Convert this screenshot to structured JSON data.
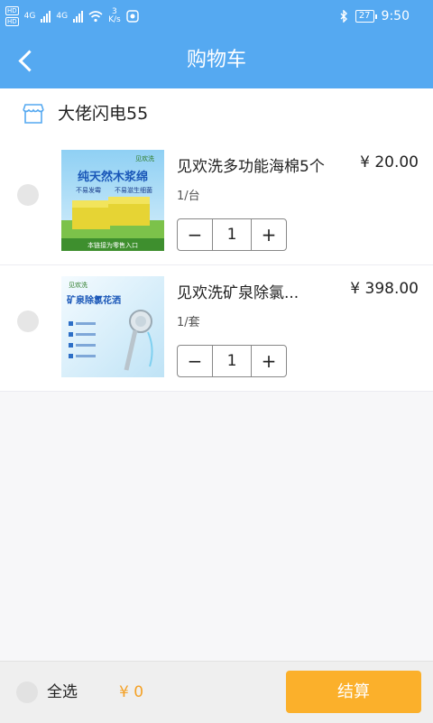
{
  "status_bar": {
    "hd_badges": [
      "HD",
      "HD"
    ],
    "network_labels": [
      "4G",
      "4G"
    ],
    "speed_value": "3",
    "speed_unit": "K/s",
    "battery": "27",
    "time": "9:50"
  },
  "nav": {
    "title": "购物车"
  },
  "store": {
    "name": "大佬闪电55"
  },
  "items": [
    {
      "name": "见欢洗多功能海棉5个",
      "price": "¥ 20.00",
      "unit": "1/台",
      "quantity": "1",
      "thumb": {
        "brand": "见欢洗",
        "headline": "纯天然木浆绵",
        "sub1": "不易发霉",
        "sub2": "不易滋生细菌",
        "footer": "本链接为零售入口"
      }
    },
    {
      "name": "见欢洗矿泉除氯...",
      "price": "¥ 398.00",
      "unit": "1/套",
      "quantity": "1",
      "thumb": {
        "brand": "见欢洗",
        "headline": "矿泉除氯花洒"
      }
    }
  ],
  "stepper": {
    "minus": "−",
    "plus": "+"
  },
  "footer": {
    "select_all": "全选",
    "total": "¥ 0",
    "checkout": "结算"
  },
  "colors": {
    "header": "#55a9f1",
    "accent": "#fbb02b",
    "total": "#f4a126"
  }
}
